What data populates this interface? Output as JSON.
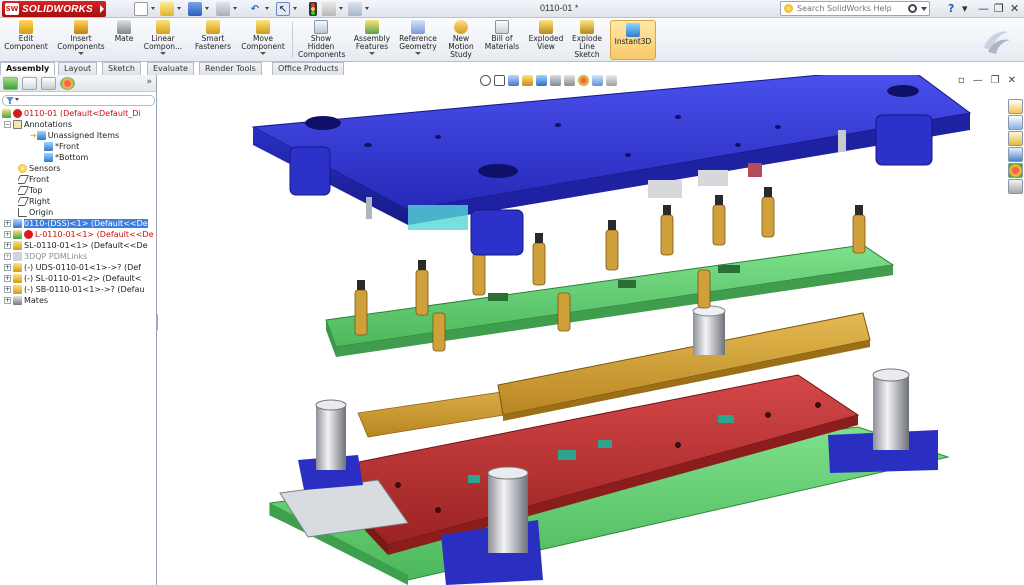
{
  "app": {
    "logo_text": "SOLIDWORKS",
    "logo_mark": "SW"
  },
  "title_bar": {
    "document": "0110-01 *",
    "search_placeholder": "Search SolidWorks Help",
    "help_label": "?"
  },
  "ribbon": {
    "buttons": [
      {
        "id": "edit-component",
        "label": "Edit\nComponent",
        "icon": "edit-component-icon"
      },
      {
        "id": "insert-components",
        "label": "Insert\nComponents",
        "icon": "insert-components-icon"
      },
      {
        "id": "mate",
        "label": "Mate",
        "icon": "mate-icon"
      },
      {
        "id": "linear-component",
        "label": "Linear\nCompon...",
        "icon": "linear-pattern-icon"
      },
      {
        "id": "smart-fasteners",
        "label": "Smart\nFasteners",
        "icon": "smart-fasteners-icon"
      },
      {
        "id": "move-component",
        "label": "Move\nComponent",
        "icon": "move-component-icon"
      },
      {
        "id": "show-hidden",
        "label": "Show\nHidden\nComponents",
        "icon": "show-hidden-icon"
      },
      {
        "id": "assembly-features",
        "label": "Assembly\nFeatures",
        "icon": "assembly-features-icon"
      },
      {
        "id": "reference-geometry",
        "label": "Reference\nGeometry",
        "icon": "reference-geometry-icon"
      },
      {
        "id": "new-motion-study",
        "label": "New\nMotion\nStudy",
        "icon": "motion-study-icon"
      },
      {
        "id": "bill-of-materials",
        "label": "Bill of\nMaterials",
        "icon": "bom-icon"
      },
      {
        "id": "exploded-view",
        "label": "Exploded\nView",
        "icon": "exploded-view-icon"
      },
      {
        "id": "explode-line-sketch",
        "label": "Explode\nLine\nSketch",
        "icon": "explode-line-icon"
      },
      {
        "id": "instant3d",
        "label": "Instant3D",
        "icon": "instant3d-icon"
      }
    ]
  },
  "command_tabs": [
    "Assembly",
    "Layout",
    "Sketch",
    "Evaluate",
    "Render Tools",
    "Office Products"
  ],
  "tree": {
    "root": "0110-01  (Default<Default_Di",
    "items": [
      {
        "label": "Annotations",
        "indent": 1
      },
      {
        "label": "Unassigned Items",
        "indent": 2
      },
      {
        "label": "*Front",
        "indent": 3
      },
      {
        "label": "*Bottom",
        "indent": 3
      },
      {
        "label": "Sensors",
        "indent": 1
      },
      {
        "label": "Front",
        "indent": 1
      },
      {
        "label": "Top",
        "indent": 1
      },
      {
        "label": "Right",
        "indent": 1
      },
      {
        "label": "Origin",
        "indent": 1
      },
      {
        "label": "0110-(DSS)<1> (Default<<De",
        "indent": 1
      },
      {
        "label": "L-0110-01<1> (Default<<De",
        "indent": 1
      },
      {
        "label": "SL-0110-01<1> (Default<<De",
        "indent": 1
      },
      {
        "label": "3DQP PDMLinks",
        "indent": 1
      },
      {
        "label": "(-) UDS-0110-01<1>->? (Def",
        "indent": 1
      },
      {
        "label": "(-) SL-0110-01<2> (Default<",
        "indent": 1
      },
      {
        "label": "(-) SB-0110-01<1>->? (Defau",
        "indent": 1
      },
      {
        "label": "Mates",
        "indent": 1
      }
    ]
  },
  "colors": {
    "top_plate": "#2f35d8",
    "spring_plate": "#6fd27f",
    "strip": "#d2a33a",
    "die_plate": "#c23535",
    "base_plate": "#4fd06b",
    "selection": "#3d7fe0"
  }
}
